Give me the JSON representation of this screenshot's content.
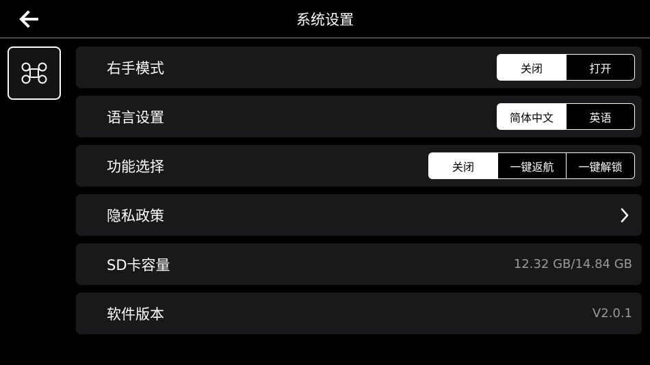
{
  "header": {
    "title": "系统设置",
    "back_icon": "arrow-left-icon"
  },
  "sidebar": {
    "active_icon": "drone-icon"
  },
  "rows": {
    "right_hand": {
      "label": "右手模式",
      "options": [
        "关闭",
        "打开"
      ],
      "selected": "关闭"
    },
    "language": {
      "label": "语言设置",
      "options": [
        "简体中文",
        "英语"
      ],
      "selected": "简体中文"
    },
    "function": {
      "label": "功能选择",
      "options": [
        "关闭",
        "一键返航",
        "一键解锁"
      ],
      "selected": "关闭"
    },
    "privacy": {
      "label": "隐私政策",
      "icon": "chevron-right-icon"
    },
    "sd_card": {
      "label": "SD卡容量",
      "value": "12.32 GB/14.84 GB"
    },
    "version": {
      "label": "软件版本",
      "value": "V2.0.1"
    }
  },
  "colors": {
    "background": "#000000",
    "row_background": "#19191b",
    "text": "#ffffff",
    "muted_text": "#9a9a9a",
    "active_segment": "#ffffff"
  }
}
